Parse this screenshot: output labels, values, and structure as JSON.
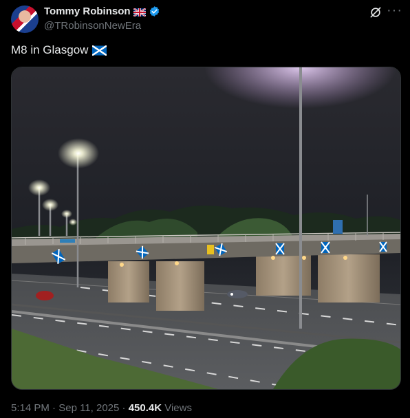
{
  "author": {
    "name": "Tommy Robinson",
    "handle": "@TRobinsonNewEra",
    "name_flag_icon": "uk-flag-icon",
    "verified_icon": "verified-badge-icon"
  },
  "header_actions": {
    "grok_icon": "grok-icon",
    "more_label": "···"
  },
  "tweet": {
    "text": "M8 in Glasgow",
    "text_flag_icon": "scotland-flag-icon"
  },
  "media": {
    "image_icon": "photo"
  },
  "footer": {
    "time": "5:14 PM",
    "sep1": " · ",
    "date": "Sep 11, 2025",
    "sep2": " · ",
    "views_count": "450.4K",
    "views_label": " Views"
  },
  "colors": {
    "background": "#000000",
    "text_primary": "#e7e9ea",
    "text_secondary": "#71767b",
    "verified_blue": "#1d9bf0"
  }
}
